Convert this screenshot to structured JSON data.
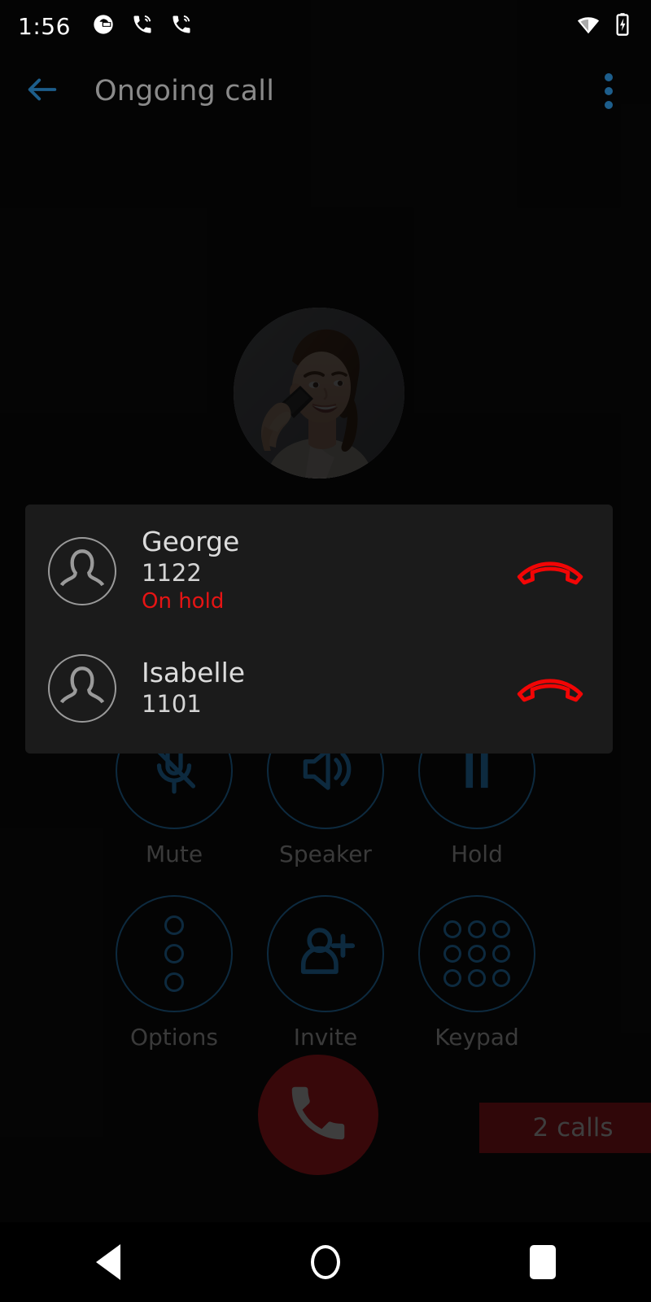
{
  "statusbar": {
    "time": "1:56",
    "left_icons": [
      "circle-logo-icon",
      "call-in-progress-icon",
      "call-in-progress-icon"
    ],
    "right_icons": [
      "wifi-icon",
      "battery-charging-icon"
    ]
  },
  "toolbar": {
    "back_icon": "arrow-left-icon",
    "title": "Ongoing call",
    "overflow_icon": "overflow-menu-icon",
    "accent_color": "#1d5e8c",
    "title_color": "#8a8a8a"
  },
  "hero": {
    "avatar_name": "caller-photo"
  },
  "controls": {
    "row1": [
      {
        "label": "Mute",
        "icon": "microphone-off-icon"
      },
      {
        "label": "Speaker",
        "icon": "speaker-icon"
      },
      {
        "label": "Hold",
        "icon": "pause-icon"
      }
    ],
    "row2": [
      {
        "label": "Options",
        "icon": "options-dots-icon"
      },
      {
        "label": "Invite",
        "icon": "person-add-icon"
      },
      {
        "label": "Keypad",
        "icon": "keypad-icon"
      }
    ],
    "color": "#1d5e8c",
    "label_color": "#808080"
  },
  "end_call": {
    "icon": "phone-hangup-icon",
    "background": "#7d1217"
  },
  "calls_badge": {
    "label": "2 calls",
    "background": "#6b1015",
    "text_color": "#8a8a8a"
  },
  "calls_dialog": {
    "background": "#1b1b1b",
    "rows": [
      {
        "name": "George",
        "number": "1122",
        "status": "On hold",
        "status_color": "#e61414",
        "avatar_icon": "person-placeholder-icon",
        "hangup_icon": "hangup-outline-icon"
      },
      {
        "name": "Isabelle",
        "number": "1101",
        "status": "",
        "status_color": "#e61414",
        "avatar_icon": "person-placeholder-icon",
        "hangup_icon": "hangup-outline-icon"
      }
    ]
  },
  "navbar": {
    "back": "back-nav-icon",
    "home": "home-nav-icon",
    "recents": "recents-nav-icon"
  }
}
